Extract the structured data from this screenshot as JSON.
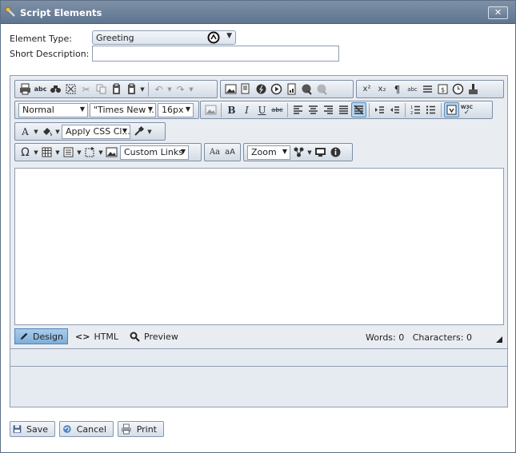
{
  "window": {
    "title": "Script Elements",
    "close_label": "✕"
  },
  "form": {
    "element_type_label": "Element Type:",
    "element_type_value": "Greeting",
    "short_description_label": "Short Description:",
    "short_description_value": ""
  },
  "toolbar": {
    "paragraph_style": "Normal",
    "font_name": "\"Times New ...",
    "font_size": "16px",
    "css_class": "Apply CSS Cl...",
    "links": "Custom Links",
    "zoom": "Zoom"
  },
  "modes": {
    "design": "Design",
    "html": "HTML",
    "preview": "Preview"
  },
  "status": {
    "words": "Words: 0",
    "characters": "Characters: 0"
  },
  "buttons": {
    "save": "Save",
    "cancel": "Cancel",
    "print": "Print"
  }
}
